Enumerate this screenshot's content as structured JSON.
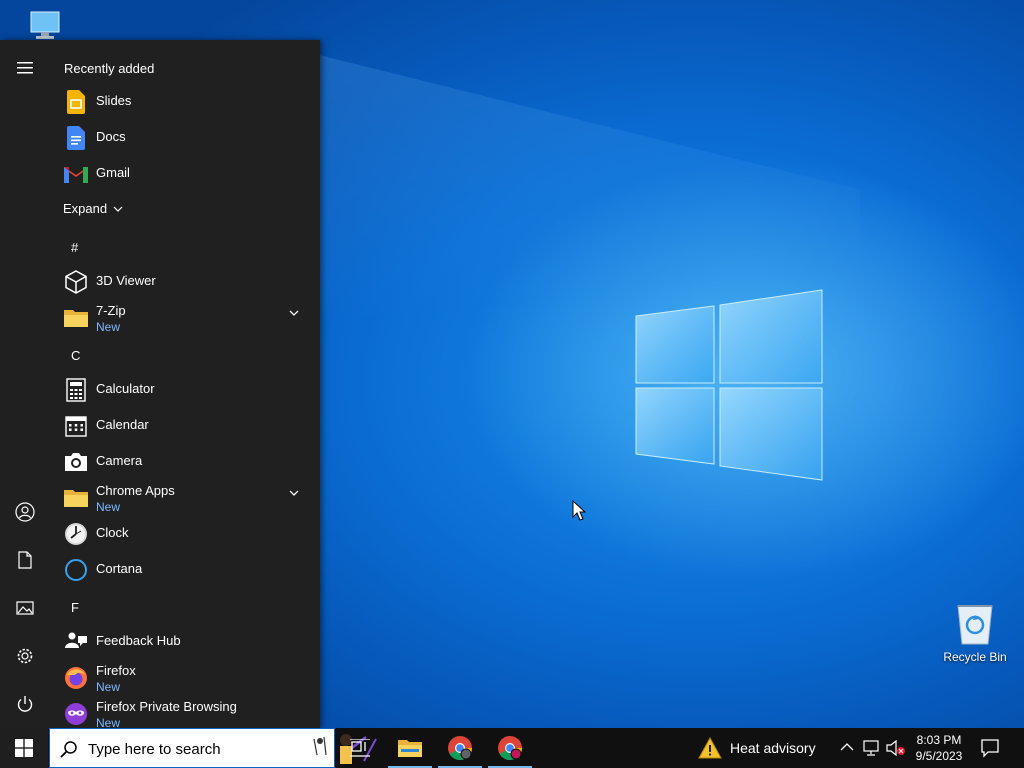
{
  "desktop": {
    "icons": [
      {
        "label": "Recycle Bin",
        "icon": "recycle-bin-icon"
      },
      {
        "label": "",
        "icon": "this-pc-icon"
      }
    ]
  },
  "start_menu": {
    "rail": [
      "hamburger-menu-icon",
      "user-icon",
      "documents-icon",
      "pictures-icon",
      "settings-gear-icon",
      "power-icon"
    ],
    "recently_added_header": "Recently added",
    "recently_added": [
      {
        "name": "Slides",
        "icon": "google-slides-icon"
      },
      {
        "name": "Docs",
        "icon": "google-docs-icon"
      },
      {
        "name": "Gmail",
        "icon": "gmail-icon"
      }
    ],
    "expand_label": "Expand",
    "groups": [
      {
        "letter": "#",
        "items": [
          {
            "name": "3D Viewer",
            "icon": "3d-viewer-icon"
          },
          {
            "name": "7-Zip",
            "sub": "New",
            "icon": "folder-icon",
            "expandable": true
          }
        ]
      },
      {
        "letter": "C",
        "items": [
          {
            "name": "Calculator",
            "icon": "calculator-icon"
          },
          {
            "name": "Calendar",
            "icon": "calendar-icon"
          },
          {
            "name": "Camera",
            "icon": "camera-icon"
          },
          {
            "name": "Chrome Apps",
            "sub": "New",
            "icon": "folder-icon",
            "expandable": true
          },
          {
            "name": "Clock",
            "icon": "clock-icon"
          },
          {
            "name": "Cortana",
            "icon": "cortana-icon"
          }
        ]
      },
      {
        "letter": "F",
        "items": [
          {
            "name": "Feedback Hub",
            "icon": "feedback-hub-icon"
          },
          {
            "name": "Firefox",
            "sub": "New",
            "icon": "firefox-icon"
          },
          {
            "name": "Firefox Private Browsing",
            "sub": "New",
            "icon": "firefox-private-icon"
          }
        ]
      }
    ]
  },
  "taskbar": {
    "search_placeholder": "Type here to search",
    "pinned": [
      "task-view-icon",
      "file-explorer-icon",
      "chrome-icon",
      "chrome-profile-icon"
    ],
    "weather": "Heat advisory",
    "time": "8:03 PM",
    "date": "9/5/2023"
  },
  "colors": {
    "start_bg": "#202020",
    "taskbar_bg": "#101010",
    "accent": "#0078d7",
    "new_label": "#7fb8ff"
  }
}
